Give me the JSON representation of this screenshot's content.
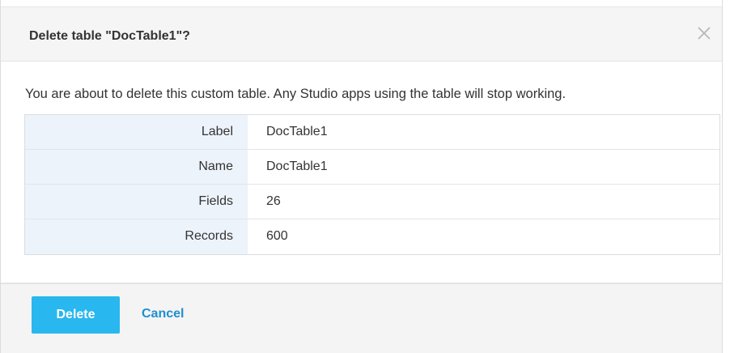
{
  "dialog": {
    "title": "Delete table \"DocTable1\"?",
    "message": "You are about to delete this custom table. Any Studio apps using the table will stop working.",
    "close_icon": "close-icon"
  },
  "details": [
    {
      "label": "Label",
      "value": "DocTable1"
    },
    {
      "label": "Name",
      "value": "DocTable1"
    },
    {
      "label": "Fields",
      "value": "26"
    },
    {
      "label": "Records",
      "value": "600"
    }
  ],
  "footer": {
    "delete_label": "Delete",
    "cancel_label": "Cancel"
  },
  "colors": {
    "primary": "#28b7ef",
    "link": "#1e8fd0",
    "label_bg": "#edf3fb"
  }
}
